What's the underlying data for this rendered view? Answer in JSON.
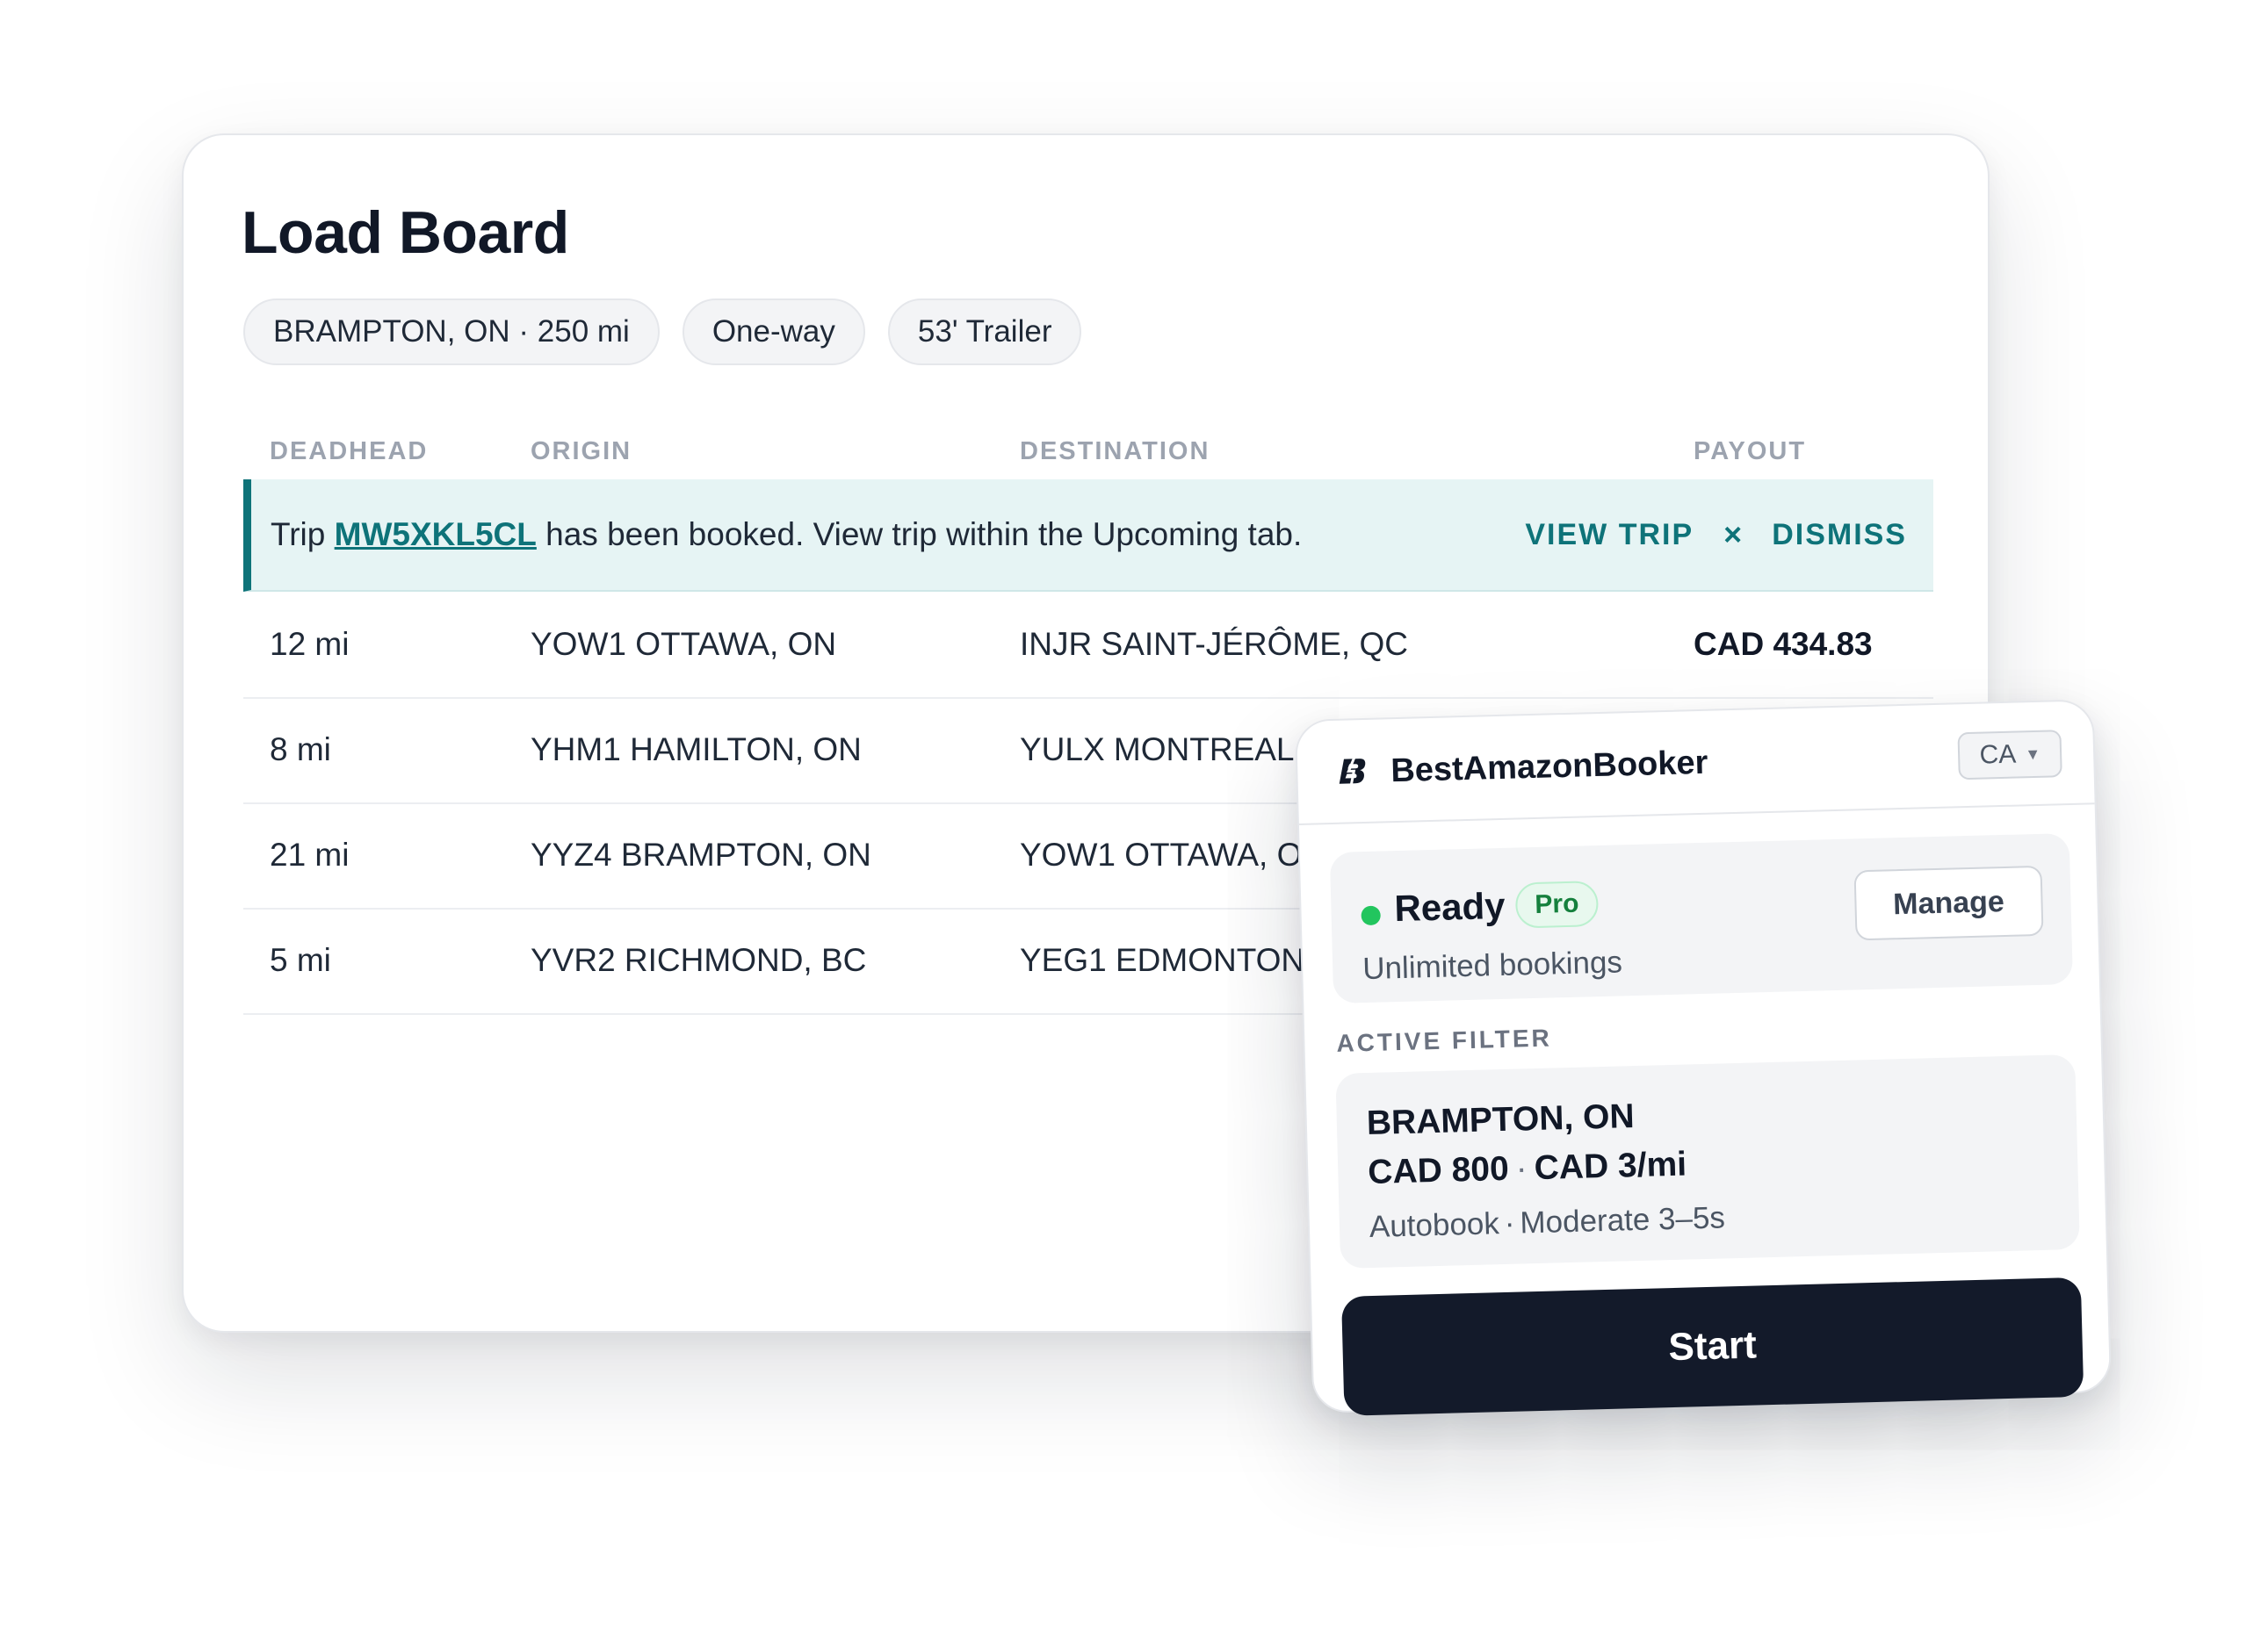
{
  "board": {
    "title": "Load Board",
    "chips": [
      "BRAMPTON, ON · 250 mi",
      "One-way",
      "53' Trailer"
    ],
    "columns": [
      "DEADHEAD",
      "ORIGIN",
      "DESTINATION",
      "PAYOUT"
    ],
    "banner": {
      "prefix": "Trip ",
      "trip_id": "MW5XKL5CL",
      "suffix": " has been booked. View trip within the Upcoming tab.",
      "view_label": "VIEW TRIP",
      "close_glyph": "×",
      "dismiss_label": "DISMISS",
      "accent_color": "#0e7379"
    },
    "rows": [
      {
        "deadhead": "12 mi",
        "origin": "YOW1 OTTAWA, ON",
        "destination": "INJR SAINT-JÉRÔME, QC",
        "payout": "CAD 434.83"
      },
      {
        "deadhead": "8 mi",
        "origin": "YHM1 HAMILTON, ON",
        "destination": "YULX MONTREAL",
        "payout": ""
      },
      {
        "deadhead": "21 mi",
        "origin": "YYZ4 BRAMPTON, ON",
        "destination": "YOW1 OTTAWA, O",
        "payout": ""
      },
      {
        "deadhead": "5 mi",
        "origin": "YVR2 RICHMOND, BC",
        "destination": "YEG1 EDMONTON",
        "payout": ""
      }
    ]
  },
  "popup": {
    "logo_icon": "lightning-b-icon",
    "brand": "BestAmazonBooker",
    "region": "CA",
    "status": {
      "label": "Ready",
      "badge": "Pro",
      "subtitle": "Unlimited bookings",
      "manage_label": "Manage",
      "dot_color": "#22c55e"
    },
    "filter": {
      "section_label": "ACTIVE FILTER",
      "location": "BRAMPTON, ON",
      "min_payout": "CAD 800",
      "rate": "CAD 3/mi",
      "mode": "Autobook",
      "speed": "Moderate 3–5s",
      "separator": "·"
    },
    "start_label": "Start",
    "start_color": "#131a2a"
  }
}
